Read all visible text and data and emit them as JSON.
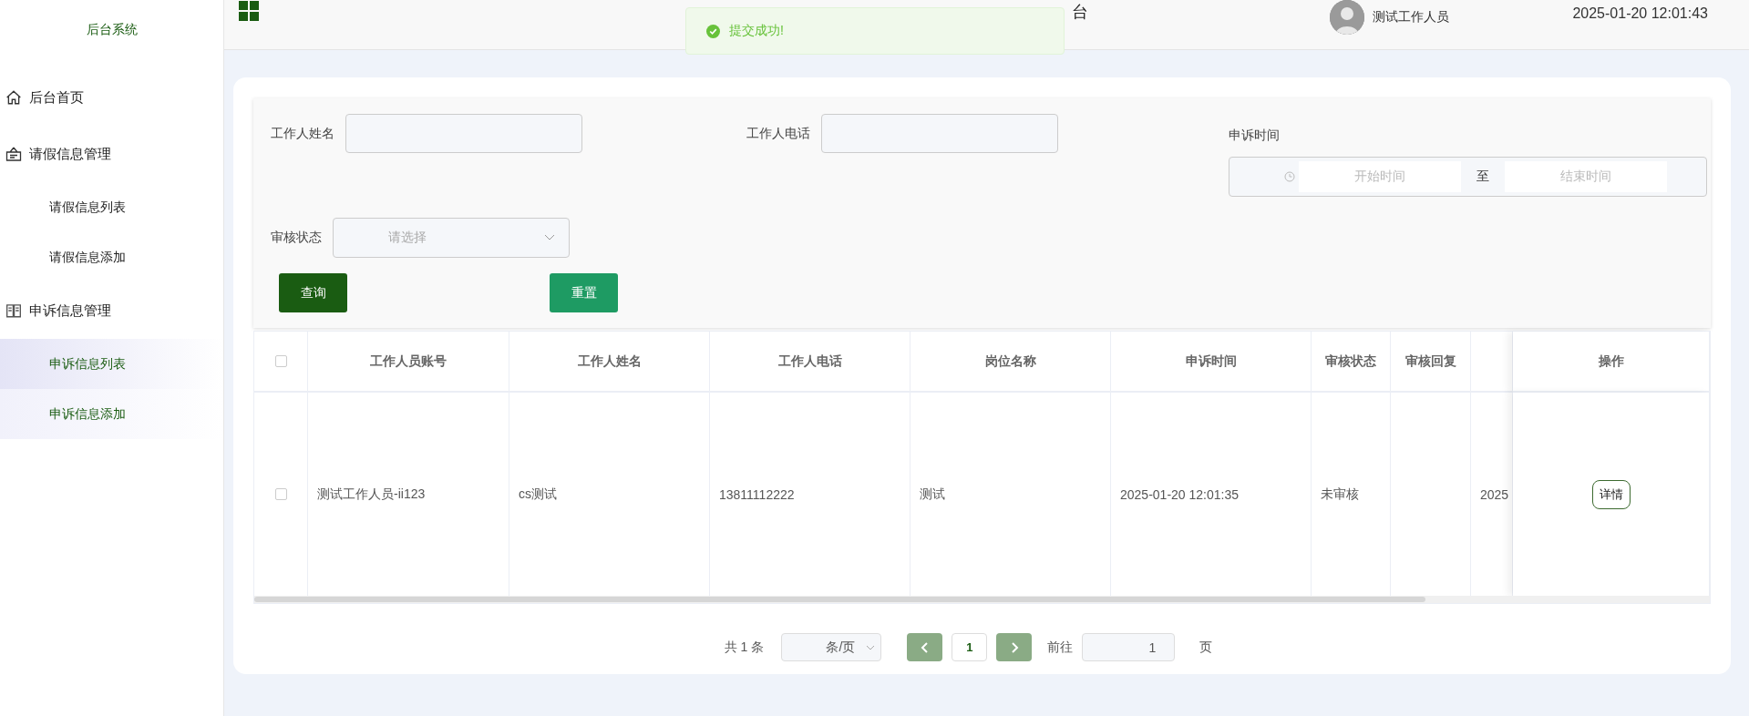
{
  "sidebar": {
    "title": "后台系统",
    "items": [
      {
        "label": "后台首页"
      },
      {
        "label": "请假信息管理",
        "children": [
          {
            "label": "请假信息列表",
            "selected": false
          },
          {
            "label": "请假信息添加",
            "selected": false
          }
        ]
      },
      {
        "label": "申诉信息管理",
        "children": [
          {
            "label": "申诉信息列表",
            "selected": true
          },
          {
            "label": "申诉信息添加",
            "selected": false
          }
        ]
      }
    ]
  },
  "header": {
    "title": "台",
    "user": "测试工作人员",
    "datetime": "2025-01-20 12:01:43"
  },
  "toast": {
    "kind": "success",
    "message": "提交成功!"
  },
  "search": {
    "fields": [
      {
        "kind": "text",
        "label": "工作人姓名"
      },
      {
        "kind": "text",
        "label": "工作人电话"
      },
      {
        "kind": "daterange",
        "label": "申诉时间",
        "start_placeholder": "开始时间",
        "separator": "至",
        "end_placeholder": "结束时间"
      },
      {
        "kind": "select",
        "label": "审核状态",
        "placeholder": "请选择"
      }
    ],
    "buttons": [
      {
        "label": "查询",
        "kind": "primary"
      },
      {
        "label": "重置",
        "kind": "secondary"
      }
    ]
  },
  "table": {
    "header_checked": false,
    "columns": [
      "工作人员账号",
      "工作人姓名",
      "工作人电话",
      "岗位名称",
      "申诉时间",
      "审核状态",
      "审核回复",
      "",
      "操作"
    ],
    "rows": [
      {
        "checked": false,
        "cells": [
          "测试工作人员-ii123",
          "cs测试",
          "13811112222",
          "测试",
          "2025-01-20 12:01:35",
          "未审核",
          "",
          "2025"
        ],
        "action": "详情"
      }
    ]
  },
  "pagination": {
    "total": "共 1 条",
    "page_size": "条/页",
    "pages": [
      {
        "label": "1",
        "selected": true
      }
    ],
    "goto_label": "前往",
    "goto_value": "1",
    "page_suffix": "页"
  }
}
